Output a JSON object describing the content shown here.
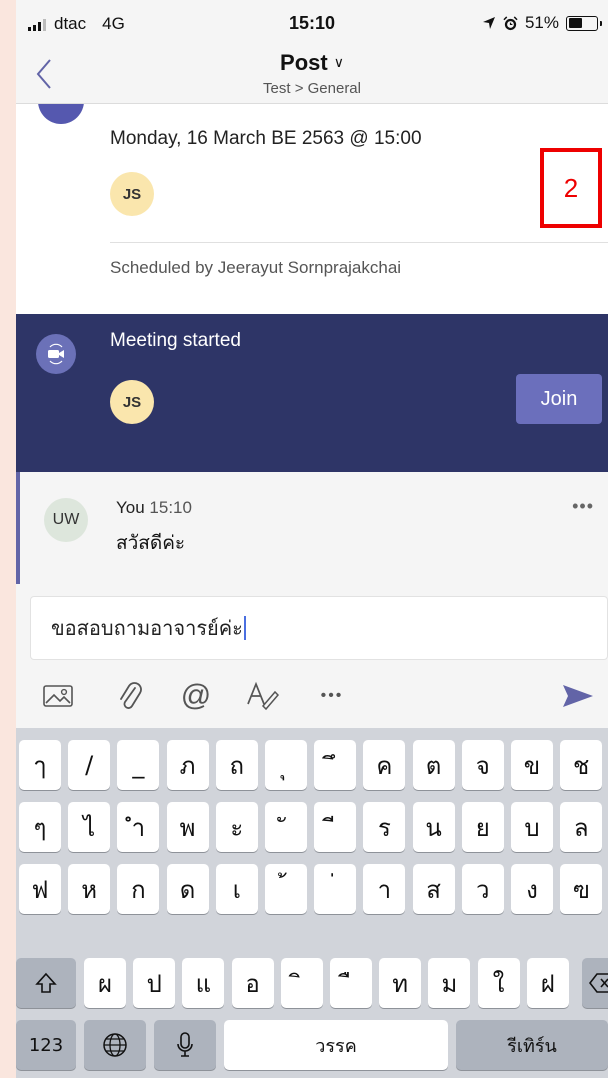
{
  "status": {
    "carrier": "dtac",
    "network": "4G",
    "time": "15:10",
    "battery": "51%",
    "battery_level": 0.51
  },
  "header": {
    "title": "Post",
    "subtitle": "Test > General"
  },
  "meeting_card": {
    "date": "Monday, 16 March BE 2563 @ 15:00",
    "attendee_initials": "JS",
    "scheduled_by": "Scheduled by Jeerayut  Sornprajakchai"
  },
  "annotation": {
    "label": "2",
    "color": "#ee0000"
  },
  "meeting_started": {
    "label": "Meeting started",
    "attendee_initials": "JS",
    "join_label": "Join"
  },
  "reply": {
    "initials": "UW",
    "author": "You",
    "time": "15:10",
    "message": "สวัสดีค่ะ",
    "more": "•••"
  },
  "compose": {
    "value": "ขอสอบถามอาจารย์ค่ะ",
    "more": "•••"
  },
  "keyboard": {
    "row1": [
      "ๅ",
      "/",
      "_",
      "ภ",
      "ถ",
      "ุ",
      "ึ",
      "ค",
      "ต",
      "จ",
      "ข",
      "ช"
    ],
    "row2": [
      "ๆ",
      "ไ",
      "ำ",
      "พ",
      "ะ",
      "ั",
      "ี",
      "ร",
      "น",
      "ย",
      "บ",
      "ล"
    ],
    "row3": [
      "ฟ",
      "ห",
      "ก",
      "ด",
      "เ",
      "้",
      "่",
      "า",
      "ส",
      "ว",
      "ง",
      "ฃ"
    ],
    "row4": [
      "ผ",
      "ป",
      "แ",
      "อ",
      "ิ",
      "ื",
      "ท",
      "ม",
      "ใ",
      "ฝ"
    ],
    "numbers": "123",
    "space": "วรรค",
    "return": "รีเทิร์น"
  },
  "colors": {
    "brand": "#6264a7",
    "meeting_bg": "#2e3567",
    "join_bg": "#6b6fbc",
    "send_icon": "#6264a7",
    "page_bg": "#fae6de"
  },
  "icons": [
    "signal-icon",
    "location-icon",
    "alarm-icon",
    "battery-icon",
    "back-chevron-icon",
    "meeting-icon",
    "camera-icon",
    "image-icon",
    "attach-icon",
    "mention-icon",
    "format-icon",
    "send-icon",
    "shift-icon",
    "globe-icon",
    "mic-icon",
    "delete-icon"
  ]
}
